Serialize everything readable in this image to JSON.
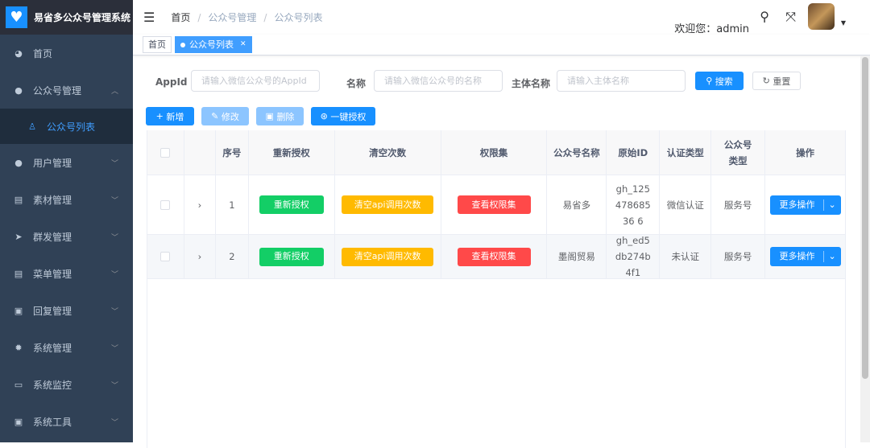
{
  "app": {
    "title": "易省多公众号管理系统",
    "logo_icon": "heart-icon"
  },
  "sidebar": {
    "items": [
      {
        "label": "首页",
        "icon": "dashboard-icon"
      },
      {
        "label": "公众号管理",
        "icon": "wechat-icon",
        "expanded": true
      },
      {
        "label": "公众号列表",
        "icon": "list-icon",
        "active": true
      },
      {
        "label": "用户管理",
        "icon": "user-icon"
      },
      {
        "label": "素材管理",
        "icon": "material-icon"
      },
      {
        "label": "群发管理",
        "icon": "send-icon"
      },
      {
        "label": "菜单管理",
        "icon": "menu-icon"
      },
      {
        "label": "回复管理",
        "icon": "reply-icon"
      },
      {
        "label": "系统管理",
        "icon": "gear-icon"
      },
      {
        "label": "系统监控",
        "icon": "monitor-icon"
      },
      {
        "label": "系统工具",
        "icon": "tool-icon"
      }
    ]
  },
  "navbar": {
    "breadcrumb": [
      "首页",
      "公众号管理",
      "公众号列表"
    ],
    "welcome": "欢迎您：admin"
  },
  "tags": {
    "home": "首页",
    "active": "公众号列表"
  },
  "search": {
    "appid_label": "AppId",
    "appid_placeholder": "请输入微信公众号的AppId",
    "name_label": "名称",
    "name_placeholder": "请输入微信公众号的名称",
    "subject_label": "主体名称",
    "subject_placeholder": "请输入主体名称",
    "search_btn": "搜索",
    "reset_btn": "重置"
  },
  "toolbar": {
    "add": "新增",
    "edit": "修改",
    "delete": "删除",
    "auth": "一键授权"
  },
  "colors": {
    "primary": "#1890ff",
    "success": "#13ce66",
    "warning": "#ffba00",
    "danger": "#ff4949",
    "sidebar": "#304156"
  },
  "table": {
    "headers": [
      "序号",
      "重新授权",
      "清空次数",
      "权限集",
      "公众号名称",
      "原始ID",
      "认证类型",
      "公众号类型",
      "操作"
    ],
    "rows": [
      {
        "index": "1",
        "reauth": "重新授权",
        "clear": "清空api调用次数",
        "perm": "查看权限集",
        "name": "易省多",
        "raw_id": "gh_12547868536 6",
        "auth_type": "微信认证",
        "type": "服务号",
        "action": "更多操作"
      },
      {
        "index": "2",
        "reauth": "重新授权",
        "clear": "清空api调用次数",
        "perm": "查看权限集",
        "name": "墨阁贸易",
        "raw_id": "gh_ed5db274b4f1",
        "auth_type": "未认证",
        "type": "服务号",
        "action": "更多操作"
      }
    ]
  }
}
